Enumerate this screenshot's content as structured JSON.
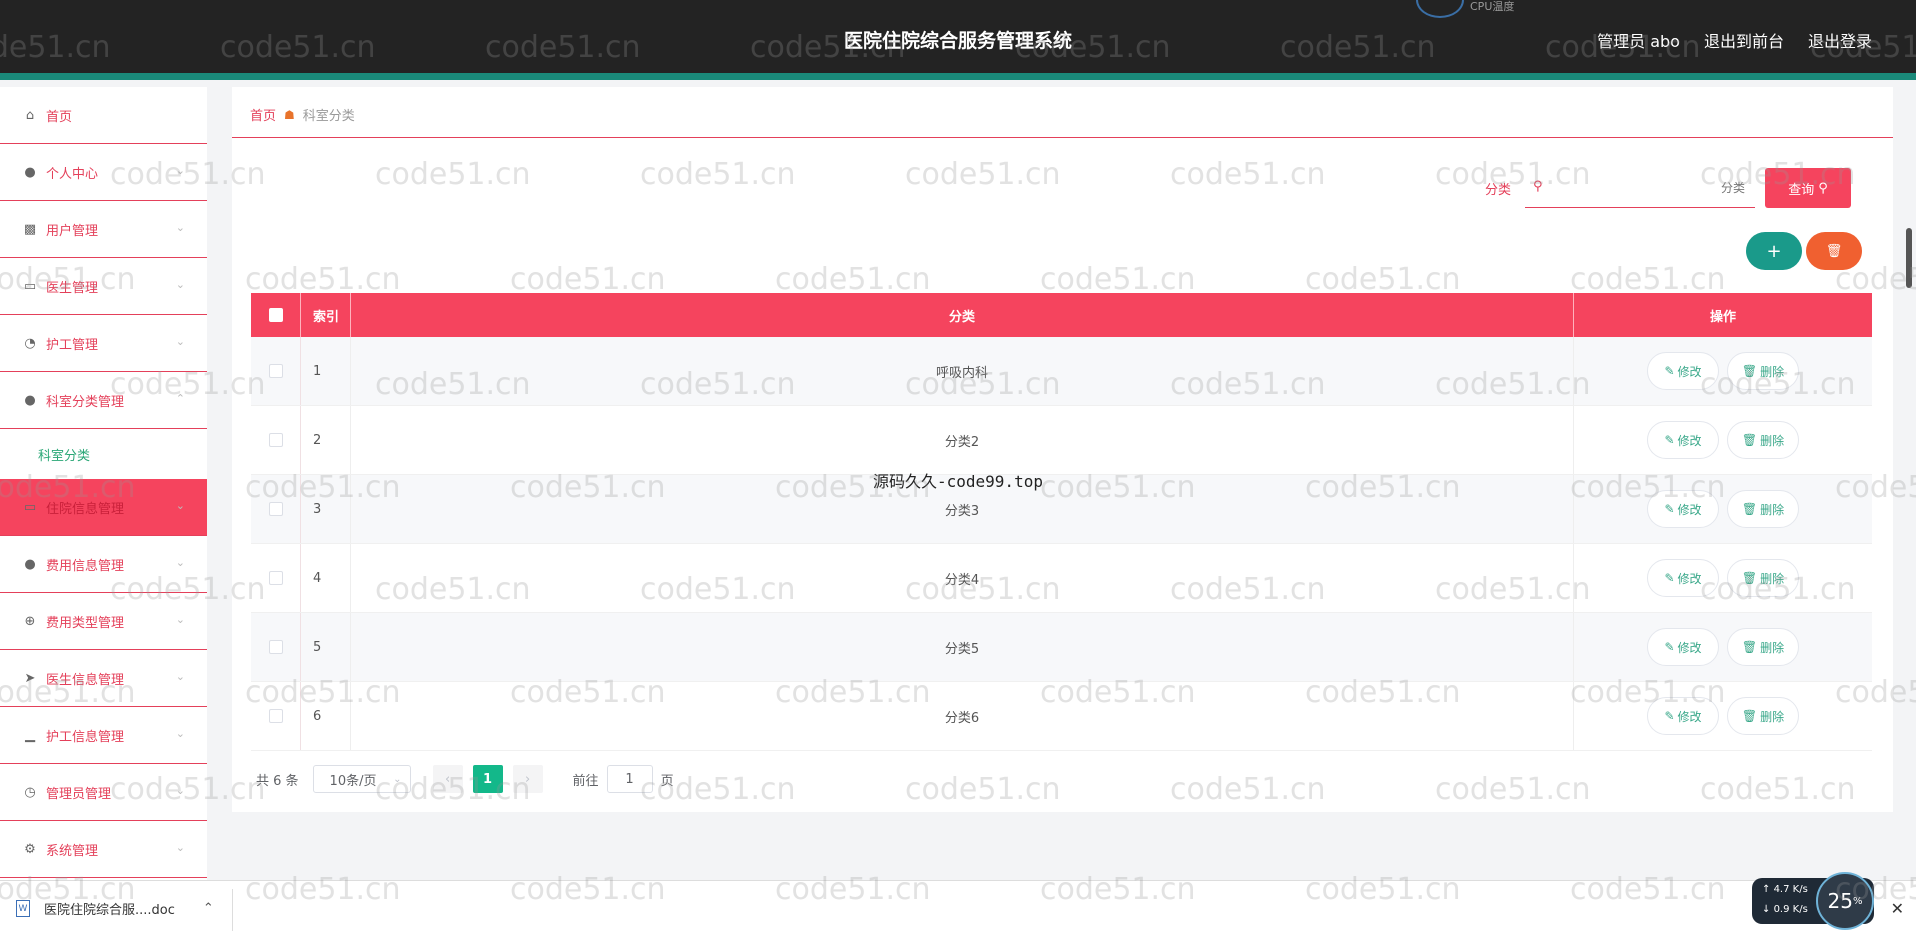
{
  "header": {
    "title": "医院住院综合服务管理系统",
    "user": "管理员 abo",
    "to_front": "退出到前台",
    "logout": "退出登录",
    "cpu_label": "CPU温度"
  },
  "sidebar": {
    "items": [
      {
        "label": "首页",
        "icon": "home-icon"
      },
      {
        "label": "个人中心",
        "icon": "user-icon"
      },
      {
        "label": "用户管理",
        "icon": "ticket-icon"
      },
      {
        "label": "医生管理",
        "icon": "monitor-icon"
      },
      {
        "label": "护工管理",
        "icon": "gauge-icon"
      },
      {
        "label": "科室分类管理",
        "icon": "person-icon"
      },
      {
        "label": "住院信息管理",
        "icon": "card-icon"
      },
      {
        "label": "费用信息管理",
        "icon": "mic-icon"
      },
      {
        "label": "费用类型管理",
        "icon": "target-icon"
      },
      {
        "label": "医生信息管理",
        "icon": "send-icon"
      },
      {
        "label": "护工信息管理",
        "icon": "bar-chart-icon"
      },
      {
        "label": "管理员管理",
        "icon": "clock-icon"
      },
      {
        "label": "系统管理",
        "icon": "settings-icon"
      }
    ],
    "submenu_label": "科室分类"
  },
  "breadcrumb": {
    "home": "首页",
    "current": "科室分类"
  },
  "search": {
    "label": "分类",
    "placeholder": "分类",
    "button": "查询"
  },
  "table": {
    "headers": {
      "index": "索引",
      "category": "分类",
      "actions": "操作"
    },
    "rows": [
      {
        "index": "1",
        "category": "呼吸内科"
      },
      {
        "index": "2",
        "category": "分类2"
      },
      {
        "index": "3",
        "category": "分类3"
      },
      {
        "index": "4",
        "category": "分类4"
      },
      {
        "index": "5",
        "category": "分类5"
      },
      {
        "index": "6",
        "category": "分类6"
      }
    ],
    "edit_label": "修改",
    "delete_label": "删除"
  },
  "pager": {
    "total": "共 6 条",
    "size": "10条/页",
    "page": "1",
    "goto_prefix": "前往",
    "goto_value": "1",
    "goto_suffix": "页"
  },
  "download": {
    "filename": "医院住院综合服....doc"
  },
  "network": {
    "up": "4.7",
    "up_unit": "K/s",
    "down": "0.9",
    "down_unit": "K/s",
    "percent": "25"
  },
  "overlay_text": "源码久久-code99.top",
  "watermark": "code51.cn"
}
